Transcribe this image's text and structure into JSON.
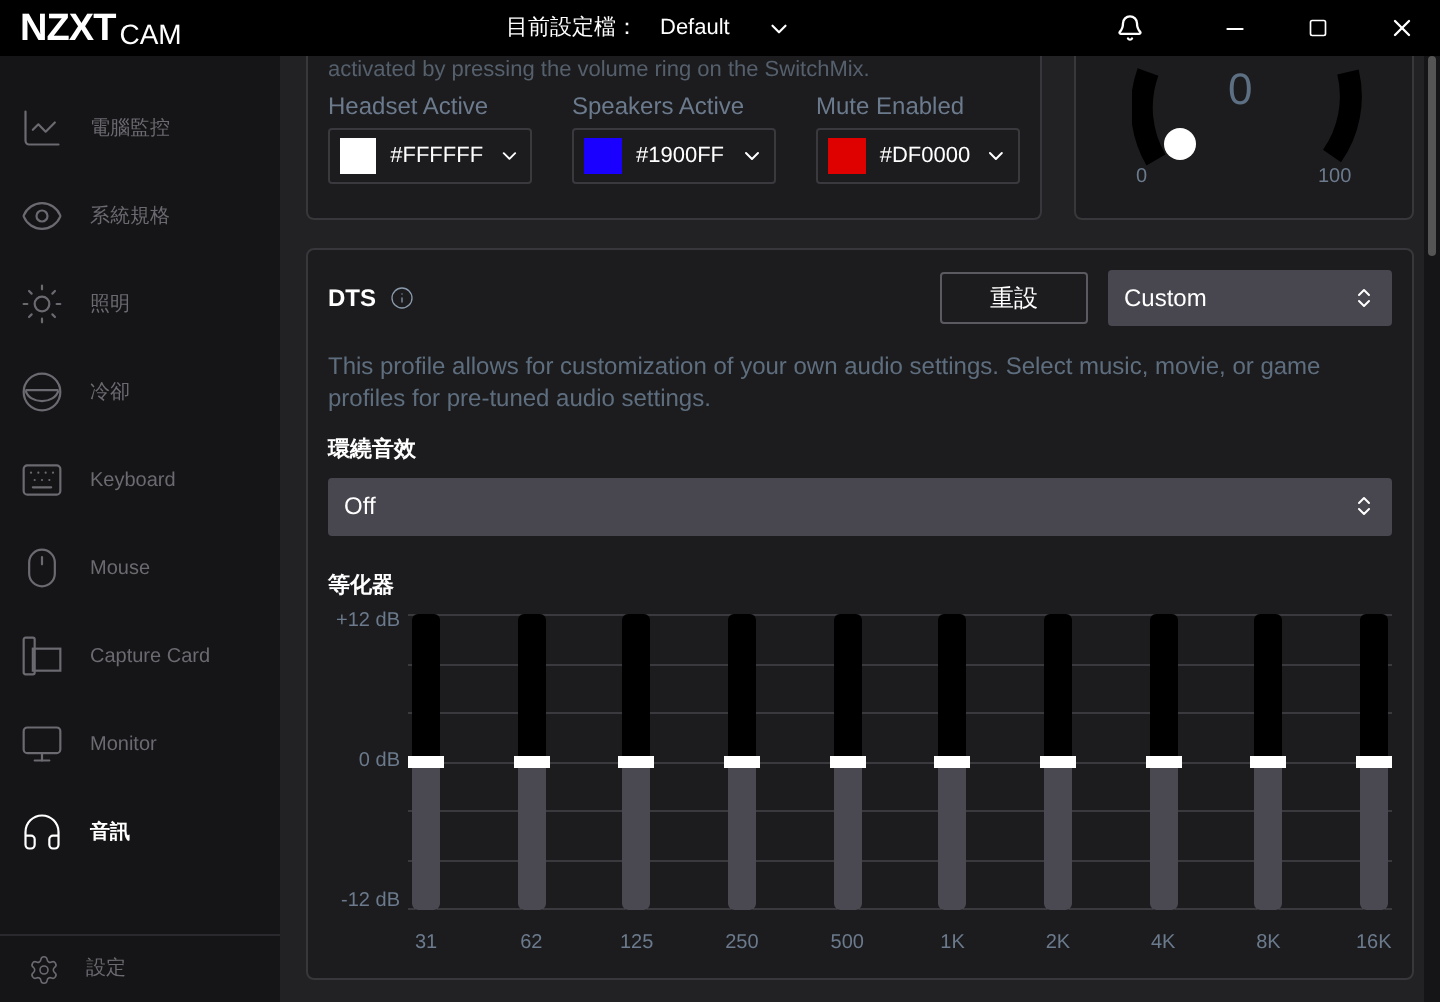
{
  "window": {
    "logo": "NZXT",
    "logo_suffix": "CAM",
    "profile_label": "目前設定檔：",
    "profile_value": "Default"
  },
  "sidebar": {
    "items": [
      {
        "label": "電腦監控",
        "selected": false
      },
      {
        "label": "系統規格",
        "selected": false
      },
      {
        "label": "照明",
        "selected": false
      },
      {
        "label": "冷卻",
        "selected": false
      },
      {
        "label": "Keyboard",
        "selected": false
      },
      {
        "label": "Mouse",
        "selected": false
      },
      {
        "label": "Capture Card",
        "selected": false
      },
      {
        "label": "Monitor",
        "selected": false
      },
      {
        "label": "音訊",
        "selected": true
      }
    ],
    "settings": "設定"
  },
  "lighting_panel": {
    "note": "activated by pressing the volume ring on the SwitchMix.",
    "colors": [
      {
        "label": "Headset Active",
        "value": "#FFFFFF",
        "color": "#ffffff"
      },
      {
        "label": "Speakers Active",
        "value": "#1900FF",
        "color": "#1900ff"
      },
      {
        "label": "Mute Enabled",
        "value": "#DF0000",
        "color": "#df0000"
      }
    ]
  },
  "dial": {
    "value": "0",
    "min": "0",
    "max": "100"
  },
  "dts": {
    "title": "DTS",
    "reset": "重設",
    "profile": "Custom",
    "description": "This profile allows for customization of your own audio settings. Select music, movie, or game profiles for pre-tuned audio settings.",
    "surround_label": "環繞音效",
    "surround_value": "Off",
    "eq_label": "等化器",
    "axis": [
      "+12 dB",
      "0 dB",
      "-12 dB"
    ],
    "bands": [
      {
        "label": "31",
        "level": 0.5
      },
      {
        "label": "62",
        "level": 0.5
      },
      {
        "label": "125",
        "level": 0.5
      },
      {
        "label": "250",
        "level": 0.5
      },
      {
        "label": "500",
        "level": 0.5
      },
      {
        "label": "1K",
        "level": 0.5
      },
      {
        "label": "2K",
        "level": 0.5
      },
      {
        "label": "4K",
        "level": 0.5
      },
      {
        "label": "8K",
        "level": 0.5
      },
      {
        "label": "16K",
        "level": 0.5
      }
    ]
  }
}
